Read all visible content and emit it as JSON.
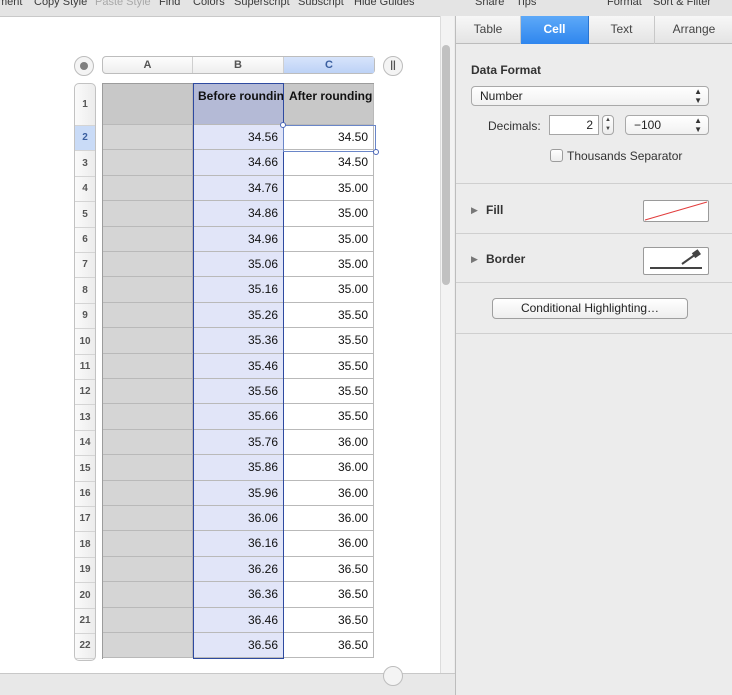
{
  "toolbar": {
    "items": [
      "ment",
      "Copy Style",
      "Paste Style",
      "Find",
      "Colors",
      "Superscript",
      "Subscript",
      "Hide Guides"
    ],
    "right_items": [
      "Share",
      "Tips",
      "Format",
      "Sort & Filter"
    ]
  },
  "table": {
    "column_headers": [
      "A",
      "B",
      "C"
    ],
    "row_numbers": [
      "1",
      "2",
      "3",
      "4",
      "5",
      "6",
      "7",
      "8",
      "9",
      "10",
      "11",
      "12",
      "13",
      "14",
      "15",
      "16",
      "17",
      "18",
      "19",
      "20",
      "21",
      "22"
    ],
    "header_b": "Before rounding",
    "header_c": "After rounding",
    "before": [
      "34.56",
      "34.66",
      "34.76",
      "34.86",
      "34.96",
      "35.06",
      "35.16",
      "35.26",
      "35.36",
      "35.46",
      "35.56",
      "35.66",
      "35.76",
      "35.86",
      "35.96",
      "36.06",
      "36.16",
      "36.26",
      "36.36",
      "36.46",
      "36.56"
    ],
    "after": [
      "34.50",
      "34.50",
      "35.00",
      "35.00",
      "35.00",
      "35.00",
      "35.00",
      "35.50",
      "35.50",
      "35.50",
      "35.50",
      "35.50",
      "36.00",
      "36.00",
      "36.00",
      "36.00",
      "36.00",
      "36.50",
      "36.50",
      "36.50",
      "36.50"
    ],
    "selected_row": "2",
    "selected_column": "C"
  },
  "inspector": {
    "tabs": [
      "Table",
      "Cell",
      "Text",
      "Arrange"
    ],
    "active_tab": "Cell",
    "data_format_title": "Data Format",
    "format_value": "Number",
    "decimals_label": "Decimals:",
    "decimals_value": "2",
    "negative_format": "−100",
    "thousands_label": "Thousands Separator",
    "thousands_checked": false,
    "fill_label": "Fill",
    "border_label": "Border",
    "conditional_button": "Conditional Highlighting…"
  },
  "colors": {
    "active_tab": "#3b8ff0",
    "selected_column_fill": "#e1e5f8",
    "header_row_fill": "#c8c8c8"
  }
}
